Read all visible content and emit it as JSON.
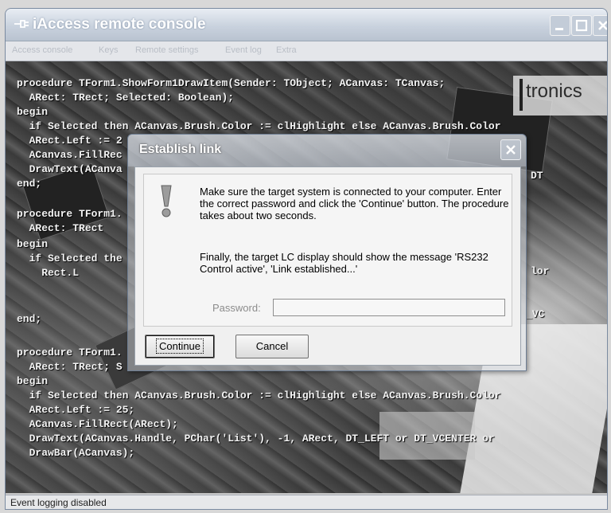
{
  "window": {
    "title": "iAccess remote console",
    "icons": {
      "app": "plug-icon",
      "minimize": "minimize-icon",
      "maximize": "maximize-icon",
      "close": "close-icon"
    }
  },
  "menu": {
    "items": [
      "Access console",
      "Keys",
      "Remote settings",
      "Event log",
      "Extra"
    ]
  },
  "console": {
    "logo_text": "tronics",
    "code_lines": [
      "procedure TForm1.ShowForm1DrawItem(Sender: TObject; ACanvas: TCanvas;",
      "  ARect: TRect; Selected: Boolean);",
      "begin",
      "  if Selected then ACanvas.Brush.Color := clHighlight else ACanvas.Brush.Color",
      "  ARect.Left := 2",
      "  ACanvas.FillRec",
      "  DrawText(ACanva",
      "end;",
      "procedure TForm1.",
      "  ARect: TRect",
      "begin",
      "  if Selected the",
      "    Rect.L",
      "end;",
      "procedure TForm1.",
      "  ARect: TRect; S",
      "begin",
      "  if Selected then ACanvas.Brush.Color := clHighlight else ACanvas.Brush.Color",
      "  ARect.Left := 25;",
      "  ACanvas.FillRect(ARect);",
      "  DrawText(ACanvas.Handle, PChar('List'), -1, ARect, DT_LEFT or DT_VCENTER or",
      "  DrawBar(ACanvas);"
    ],
    "code_fragments_right": [
      "DT",
      "lor",
      "_VC"
    ]
  },
  "dialog": {
    "title": "Establish link",
    "close_icon": "close-icon",
    "warning_icon": "exclamation-icon",
    "message_1": "Make sure the target system is connected to your computer.  Enter the correct password and click the 'Continue' button.  The procedure takes about two seconds.",
    "message_2": "Finally, the target LC display should show the message 'RS232 Control active', 'Link established...'",
    "password_label": "Password:",
    "password_value": "",
    "continue_label": "Continue",
    "cancel_label": "Cancel"
  },
  "status": {
    "text": "Event logging disabled"
  }
}
